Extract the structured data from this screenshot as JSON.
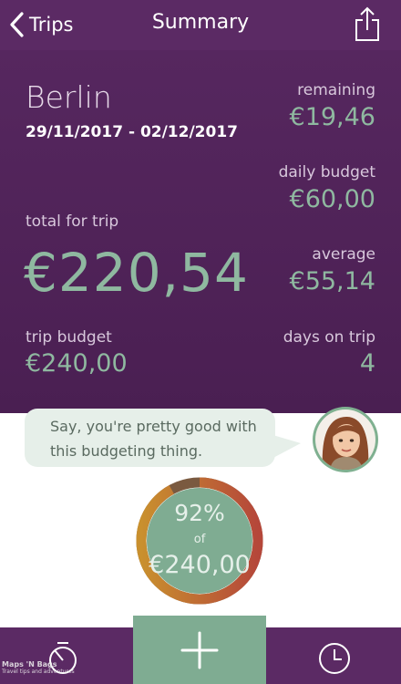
{
  "header": {
    "back_label": "Trips",
    "title": "Summary"
  },
  "trip": {
    "name": "Berlin",
    "dates": "29/11/2017 - 02/12/2017"
  },
  "stats": {
    "remaining_label": "remaining",
    "remaining_value": "€19,46",
    "daily_budget_label": "daily budget",
    "daily_budget_value": "€60,00",
    "total_label": "total for trip",
    "total_value": "€220,54",
    "average_label": "average",
    "average_value": "€55,14",
    "trip_budget_label": "trip budget",
    "trip_budget_value": "€240,00",
    "days_label": "days on trip",
    "days_value": "4"
  },
  "assistant": {
    "message_line1": "Say, you're pretty good with",
    "message_line2": "this budgeting thing."
  },
  "progress": {
    "percent_label": "92%",
    "of_label": "of",
    "amount_label": "€240,00",
    "fraction": 0.92,
    "colors": {
      "ring_used": "#c9902e",
      "ring_end": "#b5473a",
      "ring_remaining": "#7a5a40",
      "fill": "#7fac92"
    }
  },
  "watermark": {
    "line1": "Maps 'N Bags",
    "line2": "Travel tips and adventures"
  },
  "icons": {
    "back": "chevron-left-icon",
    "share": "share-icon",
    "stopwatch": "stopwatch-icon",
    "add": "plus-icon",
    "history": "clock-icon"
  },
  "colors": {
    "header": "#5b2a64",
    "accent": "#8fb8a0"
  }
}
